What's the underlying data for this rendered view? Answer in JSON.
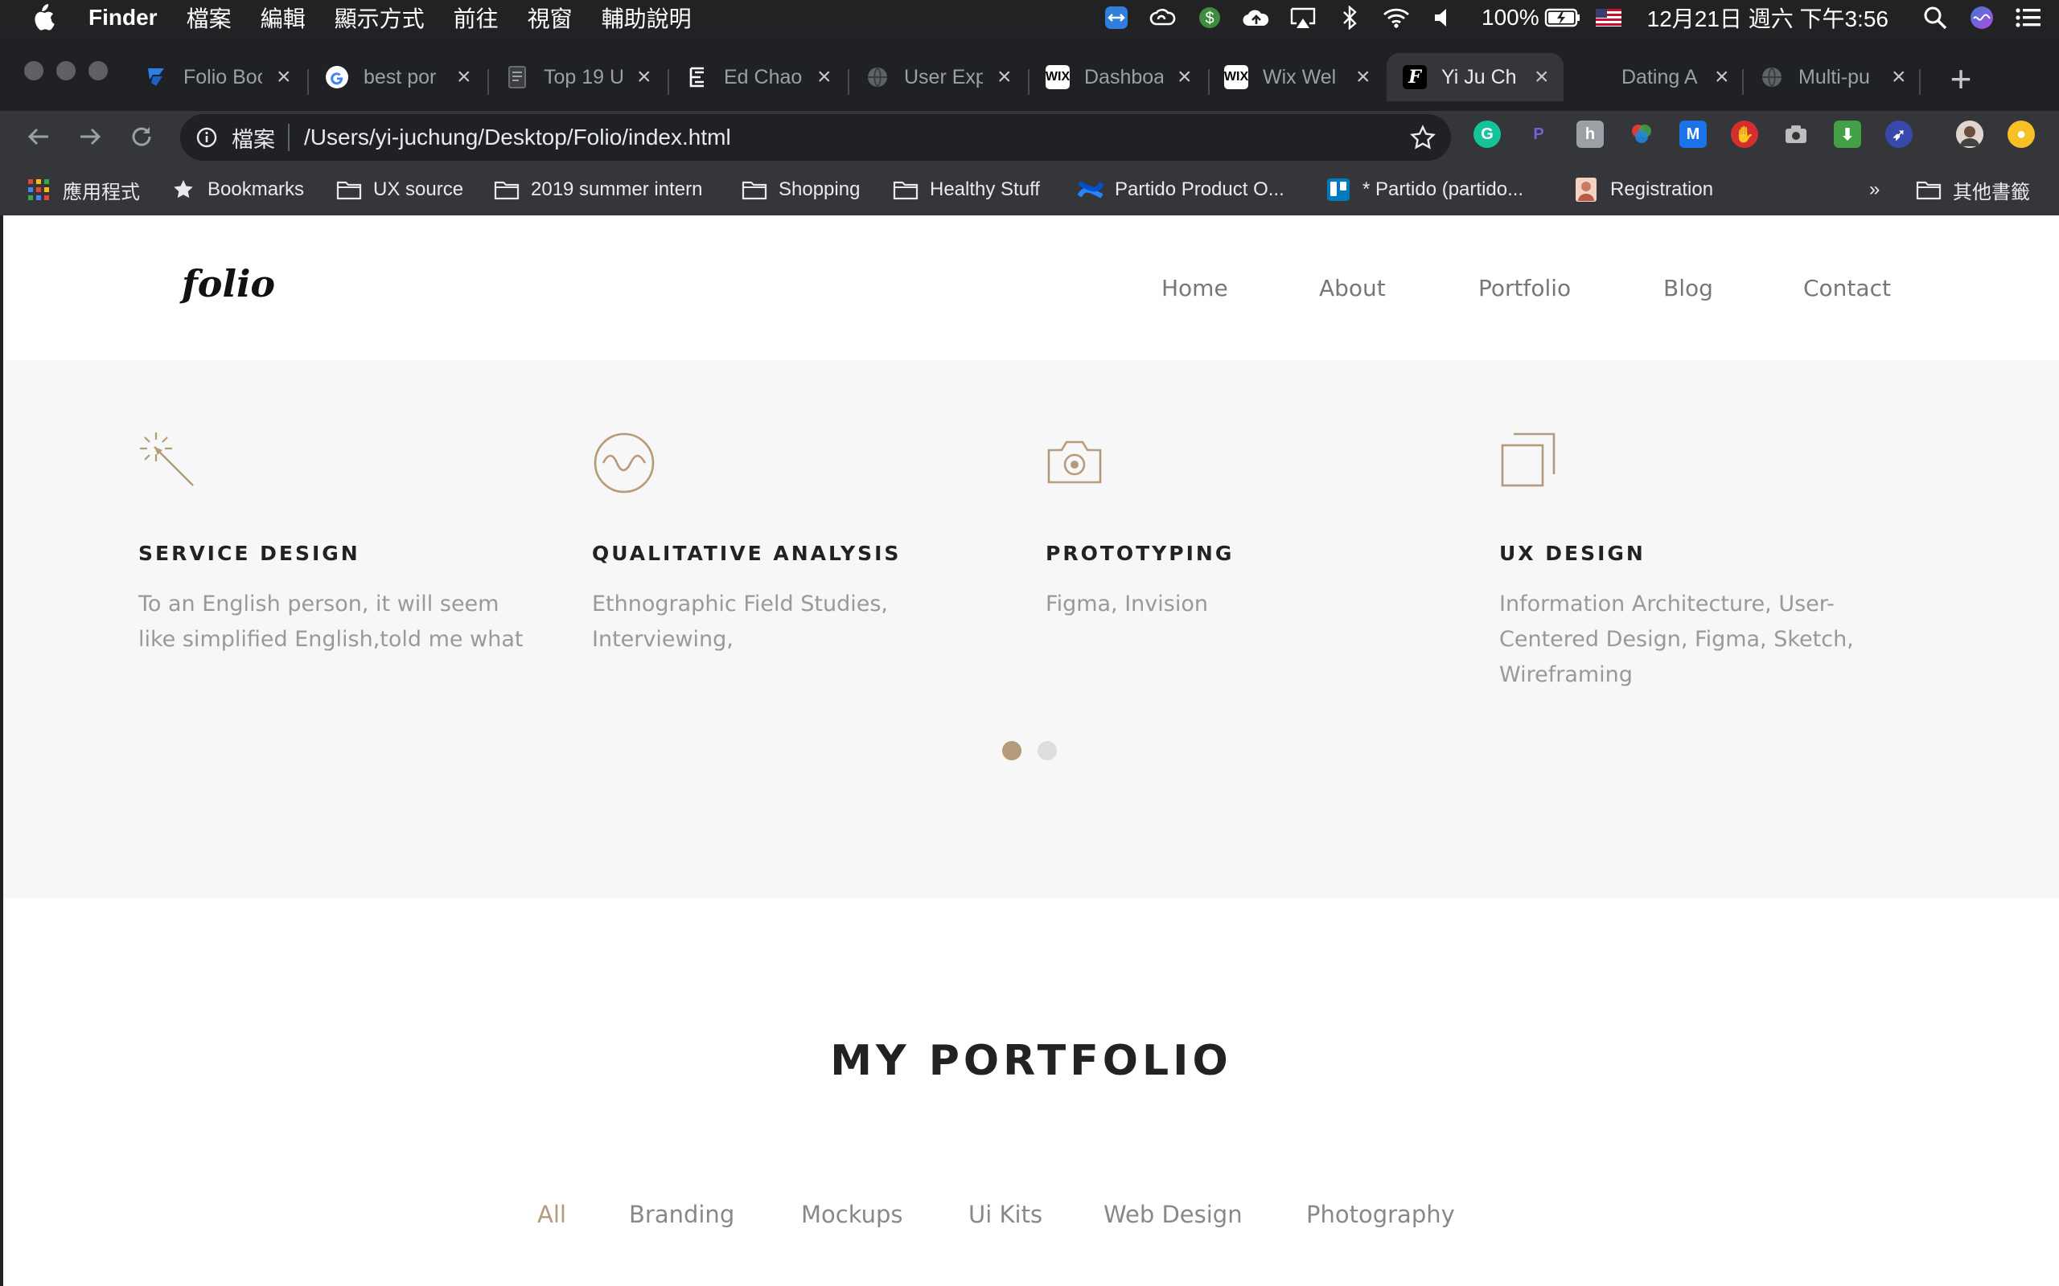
{
  "menubar": {
    "app": "Finder",
    "menus": [
      "檔案",
      "編輯",
      "顯示方式",
      "前往",
      "視窗",
      "輔助說明"
    ],
    "battery": "100%",
    "datetime": "12月21日 週六 下午3:56"
  },
  "tabs": [
    {
      "label": "Folio Boo",
      "icon": "folio-feather-icon",
      "color": "#1e88e5"
    },
    {
      "label": "best por",
      "icon": "google-icon",
      "color": "#ffffff"
    },
    {
      "label": "Top 19 U",
      "icon": "document-icon",
      "color": "#5f6368"
    },
    {
      "label": "Ed Chao",
      "icon": "e-logo-icon",
      "color": "#ffffff"
    },
    {
      "label": "User Exp",
      "icon": "globe-icon",
      "color": "#5f6368"
    },
    {
      "label": "Dashboa",
      "icon": "wix-icon",
      "color": "#ffffff"
    },
    {
      "label": "Wix Wel",
      "icon": "wix-icon",
      "color": "#ffffff"
    },
    {
      "label": "Yi Ju Ch",
      "icon": "f-logo-icon",
      "color": "#000000"
    },
    {
      "label": "Dating A",
      "icon": "blank-icon",
      "color": "#202124"
    },
    {
      "label": "Multi-pu",
      "icon": "globe-icon",
      "color": "#5f6368"
    }
  ],
  "toolbar": {
    "scheme": "檔案",
    "url": "/Users/yi-juchung/Desktop/Folio/index.html"
  },
  "bookmarks": [
    {
      "label": "應用程式",
      "icon": "apps-grid-icon"
    },
    {
      "label": "Bookmarks",
      "icon": "star-icon"
    },
    {
      "label": "UX source",
      "icon": "folder-icon"
    },
    {
      "label": "2019 summer intern",
      "icon": "folder-icon"
    },
    {
      "label": "Shopping",
      "icon": "folder-icon"
    },
    {
      "label": "Healthy Stuff",
      "icon": "folder-icon"
    },
    {
      "label": "Partido Product O...",
      "icon": "confluence-icon"
    },
    {
      "label": "* Partido (partido...",
      "icon": "trello-icon"
    },
    {
      "label": "Registration",
      "icon": "registration-icon"
    }
  ],
  "bookmarks_more": "»",
  "other_bookmarks": "其他書籤",
  "site": {
    "logo": "folio",
    "nav": [
      "Home",
      "About",
      "Portfolio",
      "Blog",
      "Contact"
    ],
    "accent": "#b59a7b",
    "services": [
      {
        "icon": "magic-wand-icon",
        "title": "SERVICE DESIGN",
        "text": "To an English person, it will seem like simplified English,told me what"
      },
      {
        "icon": "wave-circle-icon",
        "title": "QUALITATIVE ANALYSIS",
        "text": "Ethnographic Field Studies, Interviewing,"
      },
      {
        "icon": "camera-icon",
        "title": "PROTOTYPING",
        "text": "Figma, Invision"
      },
      {
        "icon": "layers-icon",
        "title": "UX DESIGN",
        "text": "Information Architecture, User-Centered Design, Figma, Sketch, Wireframing"
      }
    ],
    "carousel": {
      "pages": 2,
      "active": 1
    },
    "portfolio_title": "MY PORTFOLIO",
    "filters": [
      "All",
      "Branding",
      "Mockups",
      "Ui Kits",
      "Web Design",
      "Photography"
    ],
    "active_filter": "All"
  }
}
